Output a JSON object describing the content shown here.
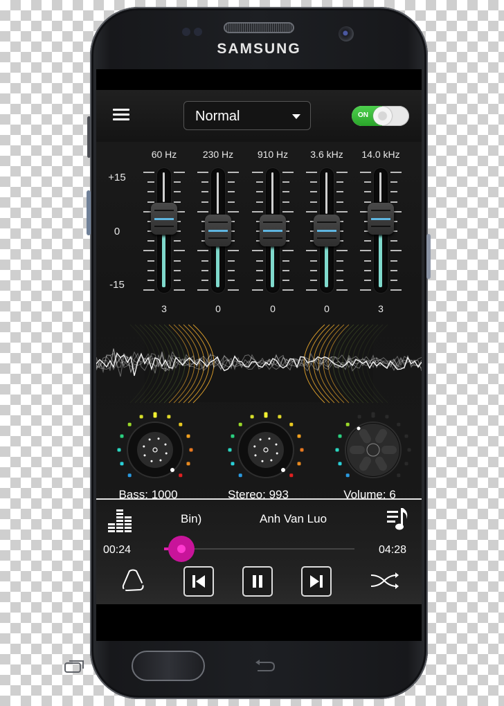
{
  "device": {
    "brand": "SAMSUNG"
  },
  "topbar": {
    "menu_icon": "hamburger-menu-icon",
    "preset": {
      "selected": "Normal"
    },
    "power_toggle": {
      "label": "ON",
      "state": true,
      "accent": "#3cbf3c"
    }
  },
  "equalizer": {
    "scale": {
      "max": "+15",
      "mid": "0",
      "min": "-15"
    },
    "range_db": [
      -15,
      15
    ],
    "bands": [
      {
        "freq": "60 Hz",
        "value": "3",
        "gain": 3
      },
      {
        "freq": "230 Hz",
        "value": "0",
        "gain": 0
      },
      {
        "freq": "910 Hz",
        "value": "0",
        "gain": 0
      },
      {
        "freq": "3.6 kHz",
        "value": "0",
        "gain": 0
      },
      {
        "freq": "14.0 kHz",
        "value": "3",
        "gain": 3
      }
    ],
    "accent": "#7fd9cc"
  },
  "visualizer": {
    "wave_color": "#ffffff",
    "ring_color": "#d59a2a"
  },
  "knobs": [
    {
      "label": "Bass: 1000",
      "level": 1.0
    },
    {
      "label": "Stereo: 993",
      "level": 0.993
    },
    {
      "label": "Volume: 6",
      "level": 0.4
    }
  ],
  "player": {
    "equalizer_icon": "equalizer-bars-icon",
    "playlist_icon": "playlist-music-icon",
    "song_left": "Bin)",
    "song_right": "Anh Van Luo",
    "elapsed": "00:24",
    "duration": "04:28",
    "progress": 0.09,
    "accent": "#e020b0",
    "controls": {
      "repeat_icon": "repeat-icon",
      "prev_icon": "skip-previous-icon",
      "pause_icon": "pause-icon",
      "next_icon": "skip-next-icon",
      "shuffle_icon": "shuffle-icon"
    }
  }
}
